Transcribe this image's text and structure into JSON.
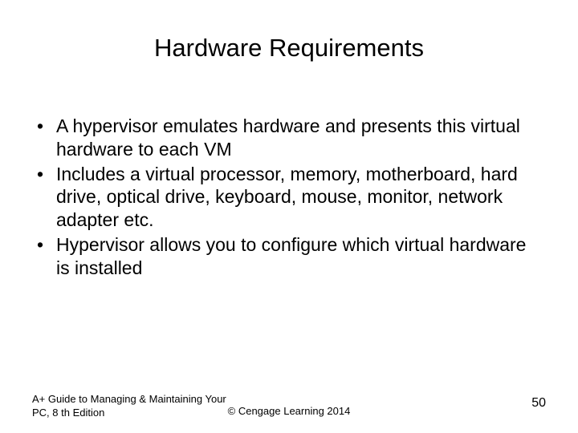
{
  "title": "Hardware Requirements",
  "bullets": [
    "A hypervisor emulates hardware and presents this virtual hardware to each VM",
    "Includes a virtual processor, memory, motherboard, hard drive, optical drive, keyboard, mouse, monitor, network adapter etc.",
    "Hypervisor allows you to configure which virtual hardware is installed"
  ],
  "footer": {
    "left": "A+ Guide to Managing & Maintaining Your PC, 8 th Edition",
    "center": "© Cengage Learning 2014",
    "page": "50"
  }
}
